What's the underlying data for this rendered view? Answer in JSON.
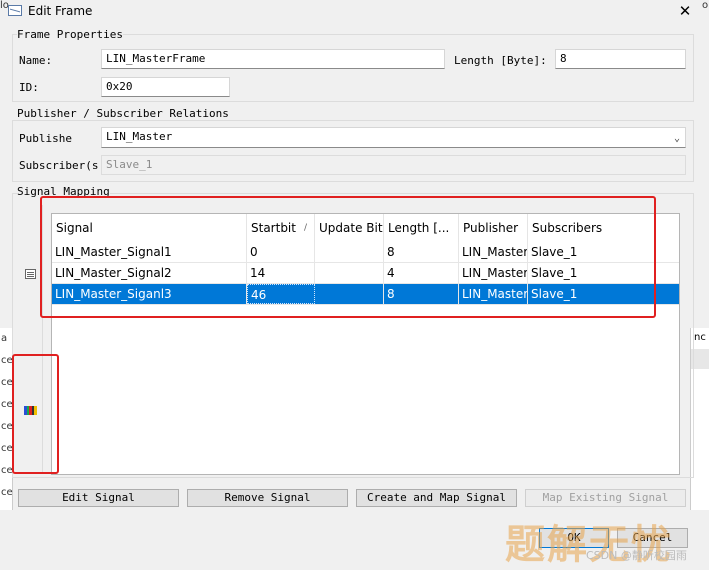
{
  "window": {
    "title": "Edit Frame",
    "close_glyph": "✕"
  },
  "frame_properties": {
    "group_label": "Frame Properties",
    "name_label": "Name:",
    "name_value": "LIN_MasterFrame",
    "length_label": "Length [Byte]:",
    "length_value": "8",
    "id_label": "ID:",
    "id_value": "0x20"
  },
  "relations": {
    "group_label": "Publisher / Subscriber Relations",
    "publisher_label": "Publishe",
    "publisher_value": "LIN_Master",
    "subscriber_label": "Subscriber(s",
    "subscriber_value": "Slave_1"
  },
  "signal_mapping": {
    "group_label": "Signal Mapping",
    "columns": [
      "Signal",
      "Startbit",
      "Update Bit",
      "Length [...",
      "Publisher",
      "Subscribers"
    ],
    "sort_indicator": "/",
    "rows": [
      {
        "signal": "LIN_Master_Signal1",
        "startbit": "0",
        "update_bit": "",
        "length": "8",
        "publisher": "LIN_Master",
        "subscribers": "Slave_1"
      },
      {
        "signal": "LIN_Master_Signal2",
        "startbit": "14",
        "update_bit": "",
        "length": "4",
        "publisher": "LIN_Master",
        "subscribers": "Slave_1"
      },
      {
        "signal": "LIN_Master_Siganl3",
        "startbit": "46",
        "update_bit": "",
        "length": "8",
        "publisher": "LIN_Master",
        "subscribers": "Slave_1"
      }
    ],
    "selected_row": 2
  },
  "buttons": {
    "edit_signal": "Edit Signal",
    "remove_signal": "Remove Signal",
    "create_and_map": "Create and Map Signal",
    "map_existing": "Map Existing Signal",
    "ok": "OK",
    "cancel": "Cancel"
  },
  "background": {
    "corner_left": "lo",
    "corner_right": "o",
    "left_strip": [
      "a",
      "ce",
      "ce",
      "ce",
      "ce",
      "ce",
      "ce",
      "ce"
    ],
    "right_strip_header": "nc"
  },
  "watermark": {
    "text": "题解无忧",
    "credit": "CSDN @静听校园雨"
  },
  "colors": {
    "selection": "#0078d7",
    "highlight": "#e02020",
    "watermark": "#e8a44d"
  },
  "icons": {
    "title": "window-icon",
    "close": "close-icon",
    "side1": "list-view-icon",
    "side2": "color-bars-icon"
  }
}
